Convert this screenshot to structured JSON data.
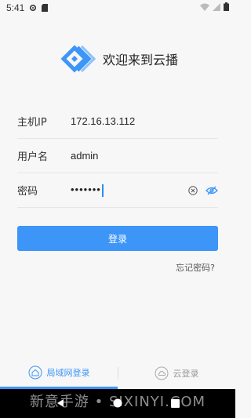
{
  "status_bar": {
    "time": "5:41"
  },
  "header": {
    "title": "欢迎来到云播"
  },
  "form": {
    "ip_label": "主机IP",
    "ip_value": "172.16.13.112",
    "user_label": "用户名",
    "user_value": "admin",
    "password_label": "密码",
    "password_masked": "•••••••"
  },
  "actions": {
    "login_label": "登录",
    "forgot_label": "忘记密码?"
  },
  "tabs": [
    {
      "label": "局域网登录",
      "icon": "home-icon",
      "active": true
    },
    {
      "label": "云登录",
      "icon": "cloud-icon",
      "active": false
    }
  ],
  "watermark": "新意手游 • SIXINYI.COM",
  "colors": {
    "accent": "#3d96f7",
    "background": "#f7f7f7"
  }
}
